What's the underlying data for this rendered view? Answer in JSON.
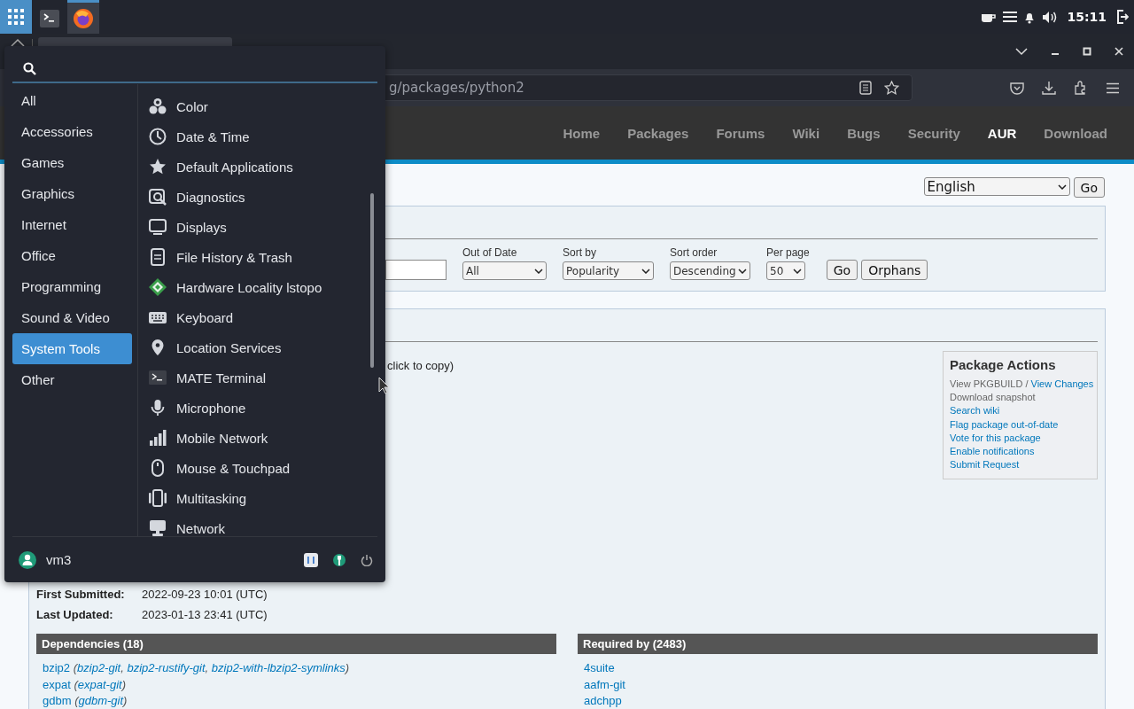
{
  "top_panel": {
    "tasks": [
      {
        "kind": "terminal",
        "selected": false
      },
      {
        "kind": "browser",
        "selected": true
      }
    ],
    "clock": "15:11"
  },
  "browser": {
    "url": "g/packages/python2",
    "nav": [
      {
        "label": "Home",
        "selected": false
      },
      {
        "label": "Packages",
        "selected": false
      },
      {
        "label": "Forums",
        "selected": false
      },
      {
        "label": "Wiki",
        "selected": false
      },
      {
        "label": "Bugs",
        "selected": false
      },
      {
        "label": "Security",
        "selected": false
      },
      {
        "label": "AUR",
        "selected": true
      },
      {
        "label": "Download",
        "selected": false
      }
    ]
  },
  "page": {
    "language": {
      "value": "English",
      "button": "Go"
    },
    "search_form": {
      "filters": [
        {
          "label": "Out of Date",
          "value": "All"
        },
        {
          "label": "Sort by",
          "value": "Popularity"
        },
        {
          "label": "Sort order",
          "value": "Descending"
        },
        {
          "label": "Per page",
          "value": "50"
        }
      ],
      "buttons": [
        "Go",
        "Orphans"
      ]
    },
    "details": {
      "copy_hint": "click to copy)",
      "actions": {
        "title": "Package Actions",
        "items": [
          [
            {
              "text": "View PKGBUILD / ",
              "link": false
            },
            {
              "text": "View Changes",
              "link": true
            }
          ],
          [
            {
              "text": "Download snapshot",
              "link": false
            }
          ],
          [
            {
              "text": "Search wiki",
              "link": true
            }
          ],
          [
            {
              "text": "Flag package out-of-date",
              "link": true
            }
          ],
          [
            {
              "text": "Vote for this package",
              "link": true
            }
          ],
          [
            {
              "text": "Enable notifications",
              "link": true
            }
          ],
          [
            {
              "text": "Submit Request",
              "link": true
            }
          ]
        ]
      },
      "info": [
        {
          "label": "First Submitted:",
          "value": "2022-09-23 10:01 (UTC)"
        },
        {
          "label": "Last Updated:",
          "value": "2023-01-13 23:41 (UTC)"
        }
      ]
    },
    "dependencies": {
      "title": "Dependencies (18)",
      "items": [
        [
          {
            "text": "bzip2",
            "link": true
          },
          {
            "text": " (",
            "link": false
          },
          {
            "text": "bzip2-git",
            "link": true
          },
          {
            "text": ", ",
            "link": false
          },
          {
            "text": "bzip2-rustify-git",
            "link": true
          },
          {
            "text": ", ",
            "link": false
          },
          {
            "text": "bzip2-with-lbzip2-symlinks",
            "link": true
          },
          {
            "text": ")",
            "link": false
          }
        ],
        [
          {
            "text": "expat",
            "link": true
          },
          {
            "text": " (",
            "link": false
          },
          {
            "text": "expat-git",
            "link": true
          },
          {
            "text": ")",
            "link": false
          }
        ],
        [
          {
            "text": "gdbm",
            "link": true
          },
          {
            "text": " (",
            "link": false
          },
          {
            "text": "gdbm-git",
            "link": true
          },
          {
            "text": ")",
            "link": false
          }
        ]
      ]
    },
    "required_by": {
      "title": "Required by (2483)",
      "items": [
        "4suite",
        "aafm-git",
        "adchpp"
      ]
    }
  },
  "app_menu": {
    "categories": [
      {
        "label": "All",
        "selected": false
      },
      {
        "label": "Accessories",
        "selected": false
      },
      {
        "label": "Games",
        "selected": false
      },
      {
        "label": "Graphics",
        "selected": false
      },
      {
        "label": "Internet",
        "selected": false
      },
      {
        "label": "Office",
        "selected": false
      },
      {
        "label": "Programming",
        "selected": false
      },
      {
        "label": "Sound & Video",
        "selected": false
      },
      {
        "label": "System Tools",
        "selected": true
      },
      {
        "label": "Other",
        "selected": false
      }
    ],
    "apps": [
      {
        "name": "Color",
        "kind": "color"
      },
      {
        "name": "Date & Time",
        "kind": "clock"
      },
      {
        "name": "Default Applications",
        "kind": "star"
      },
      {
        "name": "Diagnostics",
        "kind": "magnifier"
      },
      {
        "name": "Displays",
        "kind": "monitor"
      },
      {
        "name": "File History & Trash",
        "kind": "document"
      },
      {
        "name": "Hardware Locality lstopo",
        "kind": "diamond"
      },
      {
        "name": "Keyboard",
        "kind": "keyboard"
      },
      {
        "name": "Location Services",
        "kind": "pin"
      },
      {
        "name": "MATE Terminal",
        "kind": "terminal"
      },
      {
        "name": "Microphone",
        "kind": "microphone"
      },
      {
        "name": "Mobile Network",
        "kind": "bars"
      },
      {
        "name": "Mouse & Touchpad",
        "kind": "mouse"
      },
      {
        "name": "Multitasking",
        "kind": "windows"
      },
      {
        "name": "Network",
        "kind": "computer"
      }
    ],
    "user": "vm3"
  }
}
